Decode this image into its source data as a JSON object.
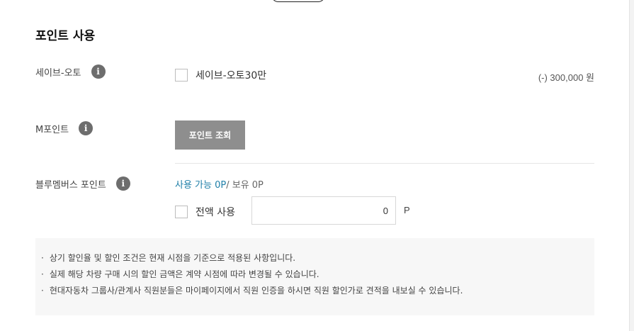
{
  "section": {
    "title": "포인트 사용"
  },
  "save_auto": {
    "label": "세이브-오토",
    "checkbox_label": "세이브-오토30만",
    "amount": "(-) 300,000 원"
  },
  "m_point": {
    "label": "M포인트",
    "lookup_button": "포인트 조회"
  },
  "blue_members": {
    "label": "블루멤버스 포인트",
    "available": "사용 가능 0P",
    "held": "/ 보유 0P",
    "use_all_label": "전액 사용",
    "input_value": "0",
    "unit": "P"
  },
  "info_icon": "info-icon",
  "notices": [
    "상기 할인율 및 할인 조건은 현재 시점을 기준으로 적용된 사항입니다.",
    "실제 해당 차량 구매 시의 할인 금액은 계약 시점에 따라 변경될 수 있습니다.",
    "현대자동차 그룹사/관계사 직원분들은 마이페이지에서 직원 인증을 하시면 직원 할인가로 견적을 내보실 수 있습니다."
  ]
}
